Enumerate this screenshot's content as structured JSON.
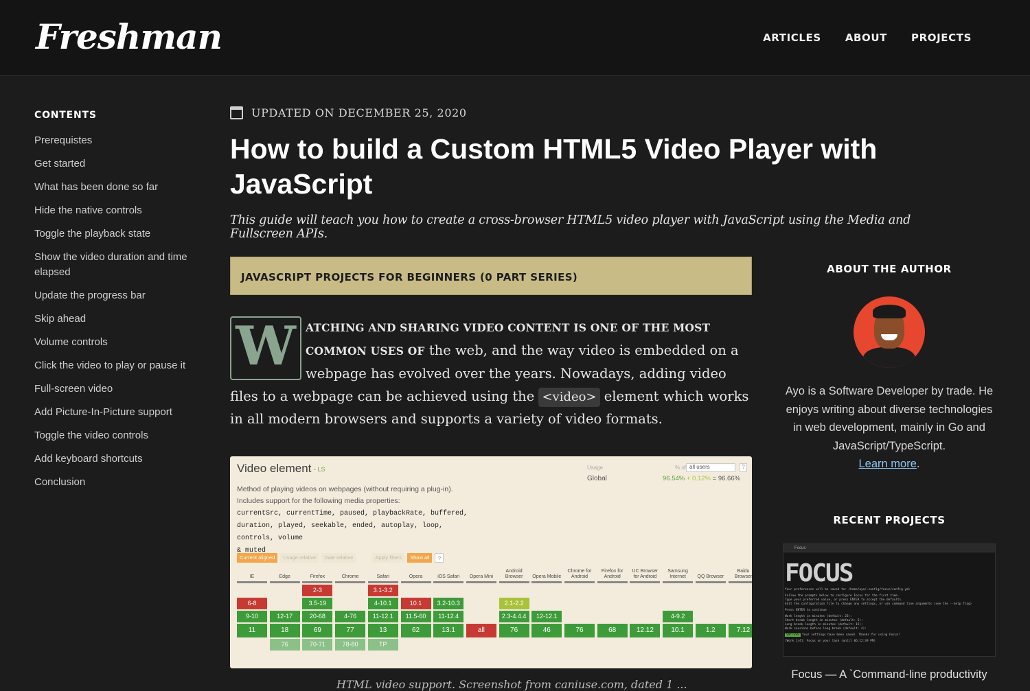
{
  "site": {
    "logo": "Freshman"
  },
  "nav": [
    "ARTICLES",
    "ABOUT",
    "PROJECTS"
  ],
  "toc": {
    "title": "CONTENTS",
    "items": [
      "Prerequistes",
      "Get started",
      "What has been done so far",
      "Hide the native controls",
      "Toggle the playback state",
      "Show the video duration and time elapsed",
      "Update the progress bar",
      "Skip ahead",
      "Volume controls",
      "Click the video to play or pause it",
      "Full-screen video",
      "Add Picture-In-Picture support",
      "Toggle the video controls",
      "Add keyboard shortcuts",
      "Conclusion"
    ]
  },
  "article": {
    "updated": "UPDATED ON DECEMBER 25, 2020",
    "title": "How to build a Custom HTML5 Video Player with JavaScript",
    "subtitle": "This guide will teach you how to create a cross-browser HTML5 video player with JavaScript using the Media and Fullscreen APIs.",
    "series": "JAVASCRIPT PROJECTS FOR BEGINNERS (0 PART SERIES)",
    "dropcap": "W",
    "lead": "ATCHING AND SHARING VIDEO CONTENT IS ONE OF THE MOST COMMON USES OF",
    "body_1": " the web, and the way video is embedded on a webpage has evolved over the years. Nowadays, adding video files to a webpage can be achieved using the ",
    "code": "<video>",
    "body_2": " element which works in all modern browsers and supports a variety of video formats.",
    "caption_cut": "HTML video support. Screenshot from caniuse.com, dated 1 ..."
  },
  "caniuse": {
    "title": "Video element",
    "ls": "- LS",
    "desc": "Method of playing videos on webpages (without requiring a plug-in). Includes support for the following media properties:",
    "props_1": "currentSrc, currentTime, paused, playbackRate, buffered,",
    "props_2": "duration, played, seekable, ended, autoplay, loop, controls, volume",
    "props_3": "& muted",
    "usage_label": "Usage",
    "global_label": "Global",
    "of_label": "% of",
    "select_value": "all users",
    "help": "?",
    "pct_supported": "96.54%",
    "pct_partial": "+ 0.12%",
    "pct_total": "= 96.66%",
    "chips": [
      "Current aligned",
      "Usage relative",
      "Date relative",
      "Apply filters",
      "Show all",
      "?"
    ],
    "browsers": [
      {
        "name": "IE",
        "cells": [
          {
            "t": "",
            "c": "e"
          },
          {
            "t": "6-8",
            "c": "r"
          },
          {
            "t": "9-10",
            "c": "g"
          },
          {
            "t": "11",
            "c": "g cur"
          },
          {
            "t": "",
            "c": "e"
          }
        ]
      },
      {
        "name": "Edge",
        "cells": [
          {
            "t": "",
            "c": "e"
          },
          {
            "t": "",
            "c": "e"
          },
          {
            "t": "12-17",
            "c": "g"
          },
          {
            "t": "18",
            "c": "g cur"
          },
          {
            "t": "76",
            "c": "lg"
          }
        ]
      },
      {
        "name": "Firefox",
        "cells": [
          {
            "t": "2-3",
            "c": "r"
          },
          {
            "t": "3.5-19",
            "c": "g"
          },
          {
            "t": "20-68",
            "c": "g"
          },
          {
            "t": "69",
            "c": "g cur"
          },
          {
            "t": "70-71",
            "c": "lg"
          }
        ]
      },
      {
        "name": "Chrome",
        "cells": [
          {
            "t": "",
            "c": "e"
          },
          {
            "t": "",
            "c": "e"
          },
          {
            "t": "4-76",
            "c": "g"
          },
          {
            "t": "77",
            "c": "g cur"
          },
          {
            "t": "78-80",
            "c": "lg"
          }
        ]
      },
      {
        "name": "Safari",
        "cells": [
          {
            "t": "3.1-3.2",
            "c": "r"
          },
          {
            "t": "4-10.1",
            "c": "g"
          },
          {
            "t": "11-12.1",
            "c": "g"
          },
          {
            "t": "13",
            "c": "g cur"
          },
          {
            "t": "TP",
            "c": "lg"
          }
        ]
      },
      {
        "name": "Opera",
        "cells": [
          {
            "t": "",
            "c": "e"
          },
          {
            "t": "10.1",
            "c": "r"
          },
          {
            "t": "11.5-60",
            "c": "g"
          },
          {
            "t": "62",
            "c": "g cur"
          },
          {
            "t": "",
            "c": "e"
          }
        ]
      },
      {
        "name": "iOS Safari",
        "cells": [
          {
            "t": "",
            "c": "e"
          },
          {
            "t": "3.2-10.3",
            "c": "g"
          },
          {
            "t": "11-12.4",
            "c": "g"
          },
          {
            "t": "13.1",
            "c": "g cur"
          },
          {
            "t": "",
            "c": "e"
          }
        ]
      },
      {
        "name": "Opera Mini",
        "cells": [
          {
            "t": "",
            "c": "e"
          },
          {
            "t": "",
            "c": "e"
          },
          {
            "t": "",
            "c": "e"
          },
          {
            "t": "all",
            "c": "r cur"
          },
          {
            "t": "",
            "c": "e"
          }
        ]
      },
      {
        "name": "Android Browser",
        "cells": [
          {
            "t": "",
            "c": "e"
          },
          {
            "t": "2.1-2.2",
            "c": "y"
          },
          {
            "t": "2.3-4.4.4",
            "c": "g"
          },
          {
            "t": "76",
            "c": "g cur"
          },
          {
            "t": "",
            "c": "e"
          }
        ]
      },
      {
        "name": "Opera Mobile",
        "cells": [
          {
            "t": "",
            "c": "e"
          },
          {
            "t": "",
            "c": "e"
          },
          {
            "t": "12-12.1",
            "c": "g"
          },
          {
            "t": "46",
            "c": "g cur"
          },
          {
            "t": "",
            "c": "e"
          }
        ]
      },
      {
        "name": "Chrome for Android",
        "cells": [
          {
            "t": "",
            "c": "e"
          },
          {
            "t": "",
            "c": "e"
          },
          {
            "t": "",
            "c": "e"
          },
          {
            "t": "76",
            "c": "g cur"
          },
          {
            "t": "",
            "c": "e"
          }
        ]
      },
      {
        "name": "Firefox for Android",
        "cells": [
          {
            "t": "",
            "c": "e"
          },
          {
            "t": "",
            "c": "e"
          },
          {
            "t": "",
            "c": "e"
          },
          {
            "t": "68",
            "c": "g cur"
          },
          {
            "t": "",
            "c": "e"
          }
        ]
      },
      {
        "name": "UC Browser for Android",
        "cells": [
          {
            "t": "",
            "c": "e"
          },
          {
            "t": "",
            "c": "e"
          },
          {
            "t": "",
            "c": "e"
          },
          {
            "t": "12.12",
            "c": "g cur"
          },
          {
            "t": "",
            "c": "e"
          }
        ]
      },
      {
        "name": "Samsung Internet",
        "cells": [
          {
            "t": "",
            "c": "e"
          },
          {
            "t": "",
            "c": "e"
          },
          {
            "t": "4-9.2",
            "c": "g"
          },
          {
            "t": "10.1",
            "c": "g cur"
          },
          {
            "t": "",
            "c": "e"
          }
        ]
      },
      {
        "name": "QQ Browser",
        "cells": [
          {
            "t": "",
            "c": "e"
          },
          {
            "t": "",
            "c": "e"
          },
          {
            "t": "",
            "c": "e"
          },
          {
            "t": "1.2",
            "c": "g cur"
          },
          {
            "t": "",
            "c": "e"
          }
        ]
      },
      {
        "name": "Baidu Browser",
        "cells": [
          {
            "t": "",
            "c": "e"
          },
          {
            "t": "",
            "c": "e"
          },
          {
            "t": "",
            "c": "e"
          },
          {
            "t": "7.12",
            "c": "g cur"
          },
          {
            "t": "",
            "c": "e"
          }
        ]
      }
    ]
  },
  "author": {
    "title": "ABOUT THE AUTHOR",
    "bio": "Ayo is a Software Developer by trade. He enjoys writing about diverse technologies in web development, mainly in Go and JavaScript/TypeScript.",
    "link": "Learn more",
    "link_suffix": "."
  },
  "projects": {
    "title": "RECENT PROJECTS",
    "caption": "Focus — A `Command-line productivity",
    "screenshot": {
      "window_title": "Focus",
      "logo": "FOCUS",
      "lines": [
        "Your preferences will be saved to: /home/ayo/.config/focus/config.yml",
        "Follow the prompts below to configure Focus for the first time.",
        "Type your preferred value, or press ENTER to accept the defaults.",
        "Edit the configuration file to change any settings, or use command line arguments (see the --help flag)",
        "Press ENTER to continue",
        "Work length in minutes (default: 25):",
        "Short break length in minutes (default: 5):",
        "Long break length in minutes (default: 15):",
        "Work sessions before long break (default: 4):",
        "Your settings have been saved. Thanks for using Focus!",
        "[Work 1/4]: Focus on your task (until 06:12:39 PM)"
      ],
      "success_tag": "SUCCESS"
    }
  }
}
